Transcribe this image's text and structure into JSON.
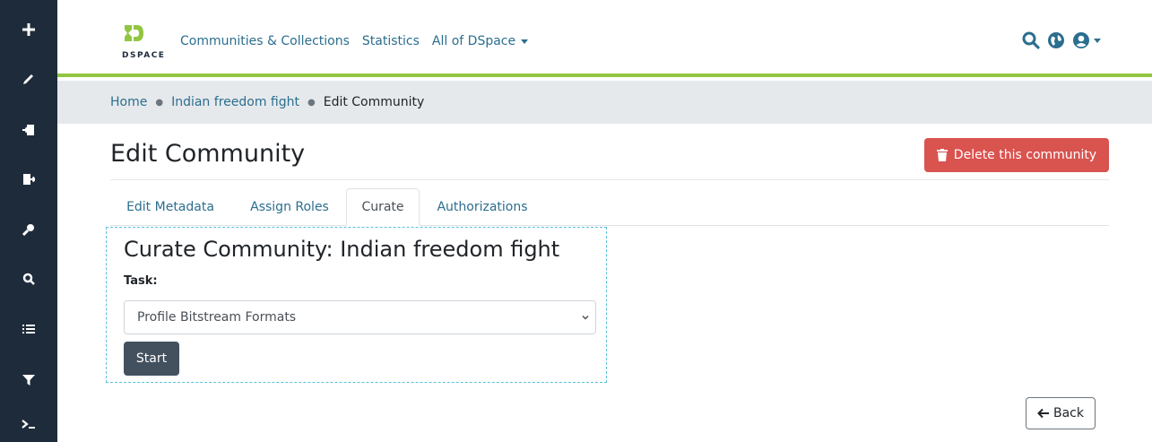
{
  "sidebar": {
    "icons": [
      "plus-icon",
      "pencil-icon",
      "import-icon",
      "export-icon",
      "key-icon",
      "search-icon",
      "list-icon",
      "filter-icon",
      "terminal-icon"
    ]
  },
  "header": {
    "logo_text": "DSPACE",
    "nav": {
      "communities": "Communities & Collections",
      "statistics": "Statistics",
      "all_of_dspace": "All of DSpace"
    },
    "icons": [
      "search-icon",
      "globe-icon",
      "user-icon"
    ]
  },
  "breadcrumb": {
    "home": "Home",
    "parent": "Indian freedom fight",
    "current": "Edit Community"
  },
  "page": {
    "title": "Edit Community",
    "delete_label": "Delete this community"
  },
  "tabs": {
    "edit_metadata": "Edit Metadata",
    "assign_roles": "Assign Roles",
    "curate": "Curate",
    "authorizations": "Authorizations",
    "active": "Curate"
  },
  "curate": {
    "title": "Curate Community: Indian freedom fight",
    "task_label": "Task:",
    "task_selected": "Profile Bitstream Formats",
    "start_label": "Start"
  },
  "back_label": "Back",
  "colors": {
    "sidebar": "#1e2b3a",
    "accent_green": "#92c642",
    "link": "#2b6e8f",
    "danger": "#d9534f",
    "start_button": "#43515f",
    "dashed_border": "#5bc0de"
  }
}
